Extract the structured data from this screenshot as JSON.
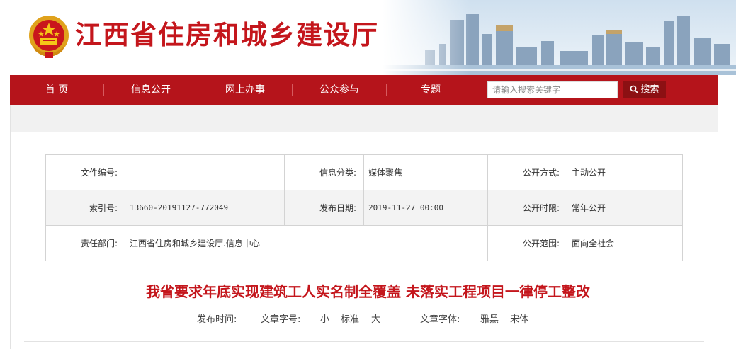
{
  "header": {
    "title": "江西省住房和城乡建设厅"
  },
  "nav": {
    "items": [
      "首 页",
      "信息公开",
      "网上办事",
      "公众参与",
      "专题"
    ],
    "search_placeholder": "请输入搜索关键字",
    "search_label": "搜索"
  },
  "info": {
    "row1": {
      "l1": "文件编号:",
      "v1": "",
      "l2": "信息分类:",
      "v2": "媒体聚焦",
      "l3": "公开方式:",
      "v3": "主动公开"
    },
    "row2": {
      "l1": "索引号:",
      "v1": "13660-20191127-772049",
      "l2": "发布日期:",
      "v2": "2019-11-27 00:00",
      "l3": "公开时限:",
      "v3": "常年公开"
    },
    "row3": {
      "l1": "责任部门:",
      "v1": "江西省住房和城乡建设厅.信息中心",
      "l3": "公开范围:",
      "v3": "面向全社会"
    }
  },
  "article": {
    "title": "我省要求年底实现建筑工人实名制全覆盖  未落实工程项目一律停工整改",
    "publish_label": "发布时间:",
    "size_label": "文章字号:",
    "size_small": "小",
    "size_standard": "标准",
    "size_large": "大",
    "font_label": "文章字体:",
    "font_yahei": "雅黑",
    "font_song": "宋体"
  },
  "colors": {
    "brand_red": "#c4161c",
    "nav_red": "#b5141b",
    "search_btn": "#8c1013"
  }
}
